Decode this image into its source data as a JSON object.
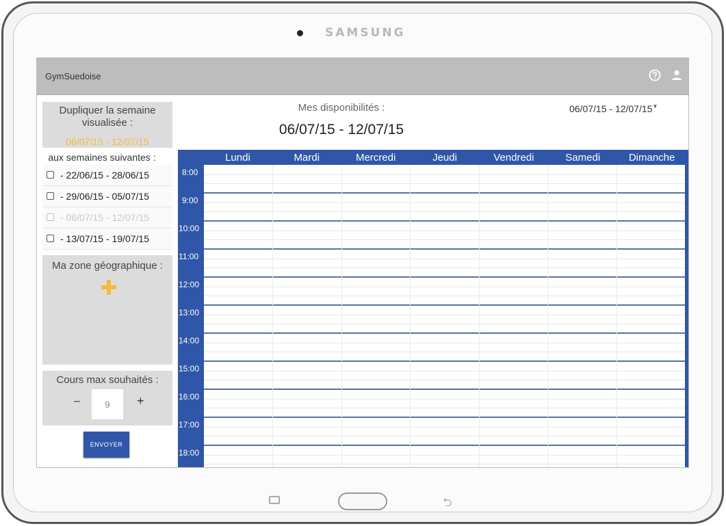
{
  "device": {
    "brand": "SAMSUNG"
  },
  "appbar": {
    "title": "GymSuedoise",
    "help_icon": "help-circle-icon",
    "user_icon": "user-icon"
  },
  "sidebar": {
    "duplicate": {
      "title": "Dupliquer la semaine visualisée :",
      "current_week": "06/07/15 - 12/07/15",
      "next_label": "aux semaines suivantes :",
      "weeks": [
        {
          "label": "- 22/06/15 - 28/06/15",
          "checked": false,
          "disabled": false
        },
        {
          "label": "- 29/06/15 - 05/07/15",
          "checked": false,
          "disabled": false
        },
        {
          "label": "- 06/07/15 - 12/07/15",
          "checked": false,
          "disabled": true
        },
        {
          "label": "- 13/07/15 - 19/07/15",
          "checked": false,
          "disabled": false
        }
      ]
    },
    "zone": {
      "title": "Ma zone géographique :",
      "add_icon": "plus-icon"
    },
    "cours": {
      "title": "Cours max souhaités :",
      "minus": "–",
      "value": "9",
      "plus": "+"
    },
    "send_label": "ENVOYER"
  },
  "main": {
    "dispo_label": "Mes disponibilités :",
    "dispo_range": "06/07/15 - 12/07/15",
    "week_select": "06/07/15 - 12/07/15"
  },
  "calendar": {
    "days": [
      "Lundi",
      "Mardi",
      "Mercredi",
      "Jeudi",
      "Vendredi",
      "Samedi",
      "Dimanche"
    ],
    "hours": [
      "8:00",
      "9:00",
      "10:00",
      "11:00",
      "12:00",
      "13:00",
      "14:00",
      "15:00",
      "16:00",
      "17:00",
      "18:00"
    ]
  },
  "colors": {
    "accent": "#2f56a8",
    "highlight": "#f2bb3a",
    "appbar": "#bdbdbd",
    "panel": "#dcdcdc"
  }
}
